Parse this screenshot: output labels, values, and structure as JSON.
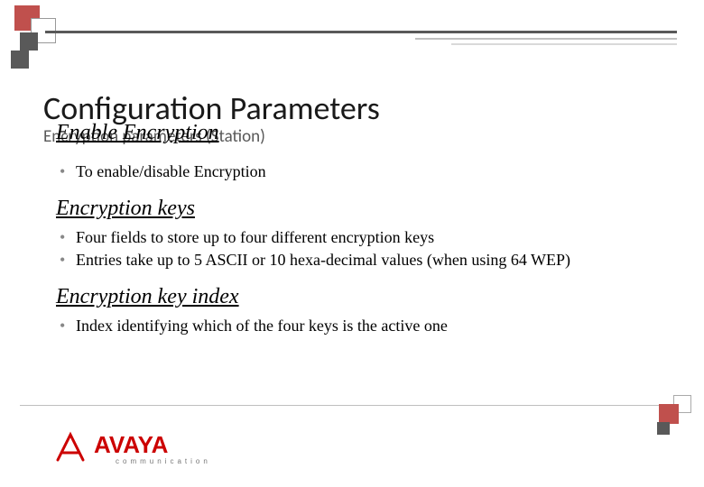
{
  "title": "Configuration Parameters",
  "subtitle": "Encryption parameters (Station)",
  "sections": [
    {
      "heading": "Enable Encryption",
      "bullets": [
        "To enable/disable Encryption"
      ]
    },
    {
      "heading": "Encryption keys",
      "bullets": [
        "Four fields to store up to four different encryption keys",
        "Entries take up to 5 ASCII or 10 hexa-decimal values (when using 64 WEP)"
      ]
    },
    {
      "heading": "Encryption key index",
      "bullets": [
        "Index identifying which of the four keys is the active one"
      ]
    }
  ],
  "logo": {
    "name": "AVAYA",
    "tagline": "communication"
  }
}
